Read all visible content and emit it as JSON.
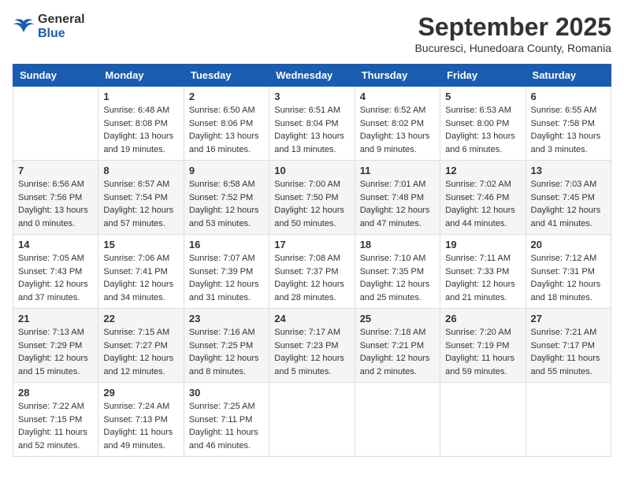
{
  "logo": {
    "general": "General",
    "blue": "Blue"
  },
  "title": "September 2025",
  "subtitle": "Bucuresci, Hunedoara County, Romania",
  "weekdays": [
    "Sunday",
    "Monday",
    "Tuesday",
    "Wednesday",
    "Thursday",
    "Friday",
    "Saturday"
  ],
  "weeks": [
    [
      {
        "day": "",
        "info": ""
      },
      {
        "day": "1",
        "info": "Sunrise: 6:48 AM\nSunset: 8:08 PM\nDaylight: 13 hours\nand 19 minutes."
      },
      {
        "day": "2",
        "info": "Sunrise: 6:50 AM\nSunset: 8:06 PM\nDaylight: 13 hours\nand 16 minutes."
      },
      {
        "day": "3",
        "info": "Sunrise: 6:51 AM\nSunset: 8:04 PM\nDaylight: 13 hours\nand 13 minutes."
      },
      {
        "day": "4",
        "info": "Sunrise: 6:52 AM\nSunset: 8:02 PM\nDaylight: 13 hours\nand 9 minutes."
      },
      {
        "day": "5",
        "info": "Sunrise: 6:53 AM\nSunset: 8:00 PM\nDaylight: 13 hours\nand 6 minutes."
      },
      {
        "day": "6",
        "info": "Sunrise: 6:55 AM\nSunset: 7:58 PM\nDaylight: 13 hours\nand 3 minutes."
      }
    ],
    [
      {
        "day": "7",
        "info": "Sunrise: 6:56 AM\nSunset: 7:56 PM\nDaylight: 13 hours\nand 0 minutes."
      },
      {
        "day": "8",
        "info": "Sunrise: 6:57 AM\nSunset: 7:54 PM\nDaylight: 12 hours\nand 57 minutes."
      },
      {
        "day": "9",
        "info": "Sunrise: 6:58 AM\nSunset: 7:52 PM\nDaylight: 12 hours\nand 53 minutes."
      },
      {
        "day": "10",
        "info": "Sunrise: 7:00 AM\nSunset: 7:50 PM\nDaylight: 12 hours\nand 50 minutes."
      },
      {
        "day": "11",
        "info": "Sunrise: 7:01 AM\nSunset: 7:48 PM\nDaylight: 12 hours\nand 47 minutes."
      },
      {
        "day": "12",
        "info": "Sunrise: 7:02 AM\nSunset: 7:46 PM\nDaylight: 12 hours\nand 44 minutes."
      },
      {
        "day": "13",
        "info": "Sunrise: 7:03 AM\nSunset: 7:45 PM\nDaylight: 12 hours\nand 41 minutes."
      }
    ],
    [
      {
        "day": "14",
        "info": "Sunrise: 7:05 AM\nSunset: 7:43 PM\nDaylight: 12 hours\nand 37 minutes."
      },
      {
        "day": "15",
        "info": "Sunrise: 7:06 AM\nSunset: 7:41 PM\nDaylight: 12 hours\nand 34 minutes."
      },
      {
        "day": "16",
        "info": "Sunrise: 7:07 AM\nSunset: 7:39 PM\nDaylight: 12 hours\nand 31 minutes."
      },
      {
        "day": "17",
        "info": "Sunrise: 7:08 AM\nSunset: 7:37 PM\nDaylight: 12 hours\nand 28 minutes."
      },
      {
        "day": "18",
        "info": "Sunrise: 7:10 AM\nSunset: 7:35 PM\nDaylight: 12 hours\nand 25 minutes."
      },
      {
        "day": "19",
        "info": "Sunrise: 7:11 AM\nSunset: 7:33 PM\nDaylight: 12 hours\nand 21 minutes."
      },
      {
        "day": "20",
        "info": "Sunrise: 7:12 AM\nSunset: 7:31 PM\nDaylight: 12 hours\nand 18 minutes."
      }
    ],
    [
      {
        "day": "21",
        "info": "Sunrise: 7:13 AM\nSunset: 7:29 PM\nDaylight: 12 hours\nand 15 minutes."
      },
      {
        "day": "22",
        "info": "Sunrise: 7:15 AM\nSunset: 7:27 PM\nDaylight: 12 hours\nand 12 minutes."
      },
      {
        "day": "23",
        "info": "Sunrise: 7:16 AM\nSunset: 7:25 PM\nDaylight: 12 hours\nand 8 minutes."
      },
      {
        "day": "24",
        "info": "Sunrise: 7:17 AM\nSunset: 7:23 PM\nDaylight: 12 hours\nand 5 minutes."
      },
      {
        "day": "25",
        "info": "Sunrise: 7:18 AM\nSunset: 7:21 PM\nDaylight: 12 hours\nand 2 minutes."
      },
      {
        "day": "26",
        "info": "Sunrise: 7:20 AM\nSunset: 7:19 PM\nDaylight: 11 hours\nand 59 minutes."
      },
      {
        "day": "27",
        "info": "Sunrise: 7:21 AM\nSunset: 7:17 PM\nDaylight: 11 hours\nand 55 minutes."
      }
    ],
    [
      {
        "day": "28",
        "info": "Sunrise: 7:22 AM\nSunset: 7:15 PM\nDaylight: 11 hours\nand 52 minutes."
      },
      {
        "day": "29",
        "info": "Sunrise: 7:24 AM\nSunset: 7:13 PM\nDaylight: 11 hours\nand 49 minutes."
      },
      {
        "day": "30",
        "info": "Sunrise: 7:25 AM\nSunset: 7:11 PM\nDaylight: 11 hours\nand 46 minutes."
      },
      {
        "day": "",
        "info": ""
      },
      {
        "day": "",
        "info": ""
      },
      {
        "day": "",
        "info": ""
      },
      {
        "day": "",
        "info": ""
      }
    ]
  ]
}
